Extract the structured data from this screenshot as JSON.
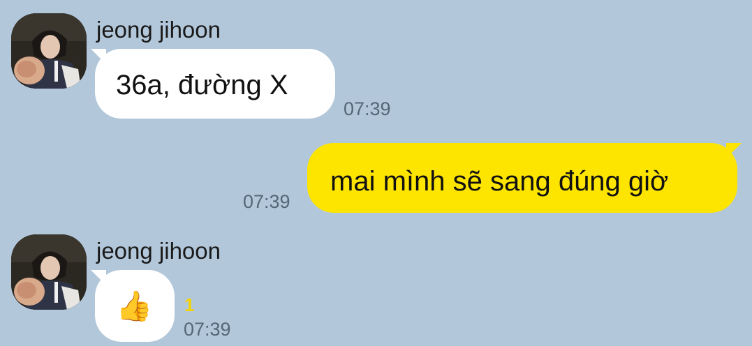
{
  "colors": {
    "background": "#b2c7d9",
    "incoming_bubble": "#ffffff",
    "outgoing_bubble": "#fee500",
    "unread_count": "#f5d400",
    "timestamp": "#556677"
  },
  "messages": [
    {
      "direction": "incoming",
      "sender": "jeong jihoon",
      "text": "36a, đường X",
      "time": "07:39"
    },
    {
      "direction": "outgoing",
      "text": "mai mình sẽ sang đúng giờ",
      "time": "07:39"
    },
    {
      "direction": "incoming",
      "sender": "jeong jihoon",
      "text": "👍",
      "emoji_name": "thumbs-up-icon",
      "unread": "1",
      "time": "07:39"
    }
  ]
}
